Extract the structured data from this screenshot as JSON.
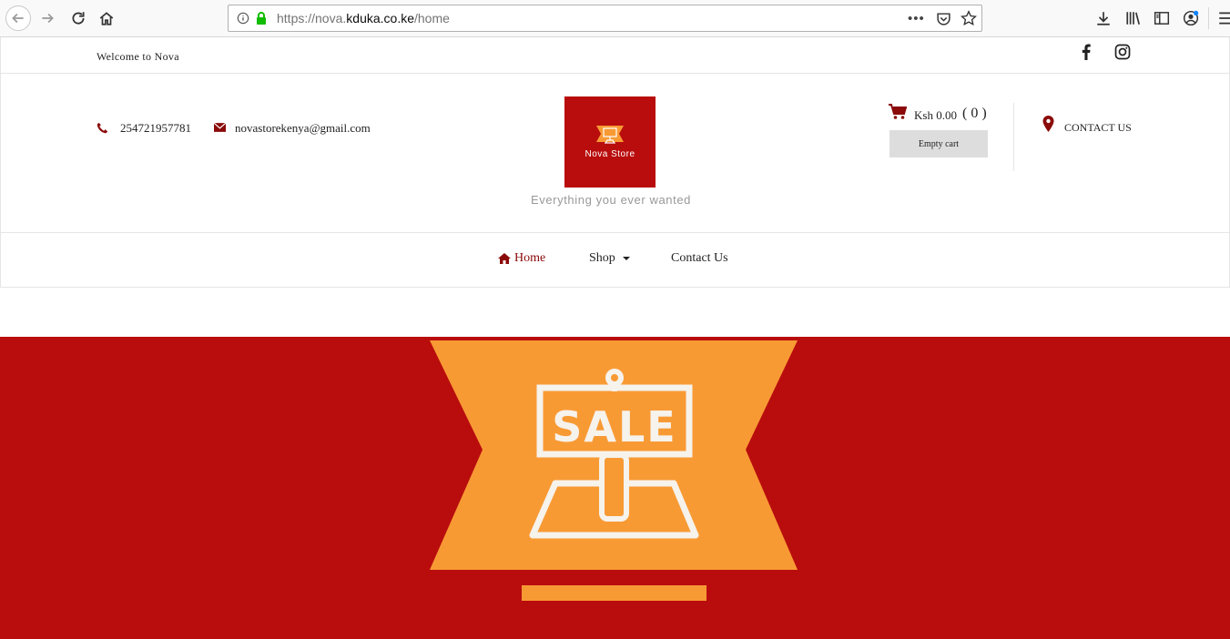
{
  "browser": {
    "url_prefix": "https://nova.",
    "url_domain": "kduka.co.ke",
    "url_path": "/home",
    "more_label": "•••"
  },
  "topbar": {
    "welcome": "Welcome to Nova",
    "social_icons": [
      "facebook-icon",
      "instagram-icon"
    ]
  },
  "header": {
    "phone": "254721957781",
    "email": "novastorekenya@gmail.com",
    "logo_text": "Nova Store",
    "tagline": "Everything you ever wanted",
    "cart_amount": "Ksh 0.00",
    "cart_count": "( 0 )",
    "empty_cart_label": "Empty cart",
    "contact_label": "CONTACT US"
  },
  "nav": {
    "home": "Home",
    "shop": "Shop",
    "contact": "Contact Us"
  },
  "banner": {
    "sale_text": "SALE"
  },
  "colors": {
    "brand_red": "#b90d0d",
    "accent_orange": "#f89a34",
    "nav_active": "#8b0a0a"
  }
}
